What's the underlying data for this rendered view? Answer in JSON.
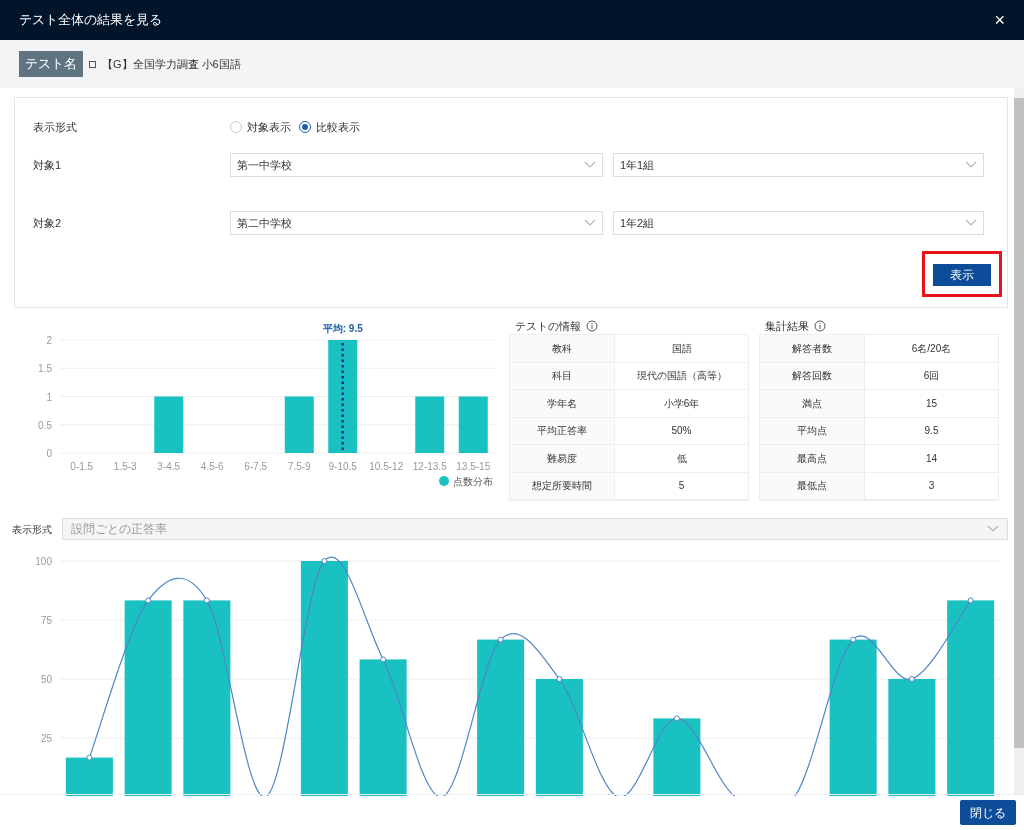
{
  "window": {
    "title": "テスト全体の結果を見る",
    "close": "×"
  },
  "test_name": {
    "label": "テスト名",
    "value": "【G】全国学力調査 小6国語"
  },
  "form": {
    "rows": [
      {
        "kind": "radio",
        "label": "表示形式",
        "options": [
          {
            "label": "対象表示",
            "selected": false
          },
          {
            "label": "比較表示",
            "selected": true
          }
        ]
      },
      {
        "kind": "selects",
        "label": "対象1",
        "selects": [
          "第一中学校",
          "1年1組"
        ]
      },
      {
        "kind": "selects",
        "label": "対象2",
        "selects": [
          "第二中学校",
          "1年2組"
        ]
      }
    ],
    "submit": "表示",
    "submit_highlighted": true
  },
  "histogram": {
    "chart_data": {
      "type": "bar",
      "categories": [
        "0-1.5",
        "1.5-3",
        "3-4.5",
        "4.5-6",
        "6-7.5",
        "7.5-9",
        "9-10.5",
        "10.5-12",
        "12-13.5",
        "13.5-15"
      ],
      "ylim": [
        0,
        2
      ],
      "yticks": [
        {
          "value": 0,
          "label": "0"
        },
        {
          "value": 0.5,
          "label": "0.5"
        },
        {
          "value": 1,
          "label": "1"
        },
        {
          "value": 1.5,
          "label": "1.5"
        },
        {
          "value": 2,
          "label": "2"
        }
      ],
      "series": [
        {
          "name": "点数分布",
          "color": "#19c1c1",
          "values": [
            0,
            0,
            1,
            0,
            0,
            1,
            2,
            0,
            1,
            1
          ]
        }
      ],
      "grid": true,
      "ref_lines": [
        {
          "axis": "x",
          "value": "9-10.5",
          "label": "平均: 9.5",
          "color": "#1d2f8c"
        }
      ]
    }
  },
  "info_tables": [
    {
      "title": "テストの情報",
      "rows": [
        [
          "教科",
          "国語"
        ],
        [
          "科目",
          "現代の国語（高等）"
        ],
        [
          "学年名",
          "小学6年"
        ],
        [
          "平均正答率",
          "50%"
        ],
        [
          "難易度",
          "低"
        ],
        [
          "想定所要時間",
          "5"
        ]
      ]
    },
    {
      "title": "集計結果",
      "rows": [
        [
          "解答者数",
          "6名/20名"
        ],
        [
          "解答回数",
          "6回"
        ],
        [
          "満点",
          "15"
        ],
        [
          "平均点",
          "9.5"
        ],
        [
          "最高点",
          "14"
        ],
        [
          "最低点",
          "3"
        ]
      ]
    }
  ],
  "display_select": {
    "label": "表示形式",
    "placeholder": "設問ごとの正答率"
  },
  "question_chart": {
    "chart_data": {
      "type": "bar",
      "ylim": [
        0,
        100
      ],
      "yticks": [
        {
          "value": 25,
          "label": "25"
        },
        {
          "value": 50,
          "label": "50"
        },
        {
          "value": 75,
          "label": "75"
        },
        {
          "value": 100,
          "label": "100"
        }
      ],
      "grid": true,
      "series": [
        {
          "type": "bar",
          "color": "#19c1c1",
          "values": [
            16.7,
            83.3,
            83.3,
            0,
            100,
            58.3,
            0,
            66.7,
            50,
            0,
            33.3,
            0,
            0,
            66.7,
            50,
            83.3
          ]
        },
        {
          "type": "line",
          "color": "#4f86c6",
          "values": [
            16.7,
            83.3,
            83.3,
            0,
            100,
            58.3,
            0,
            66.7,
            50,
            0,
            33.3,
            0,
            0,
            66.7,
            50,
            83.3
          ]
        }
      ]
    }
  },
  "footer": {
    "close_button": "閉じる"
  }
}
